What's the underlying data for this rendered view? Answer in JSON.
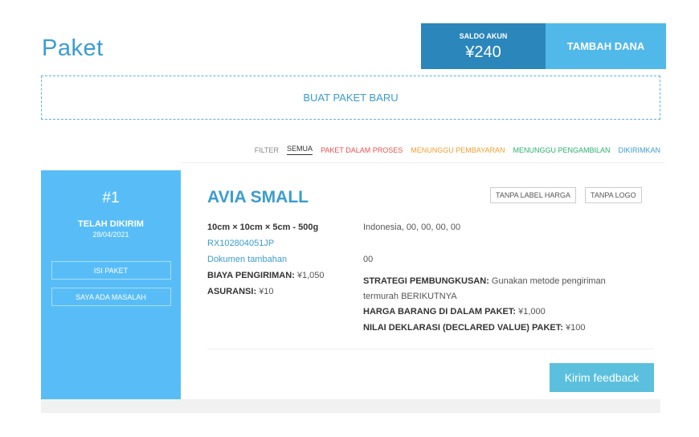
{
  "page": {
    "title": "Paket"
  },
  "account": {
    "balance_label": "SALDO AKUN",
    "balance_value": "¥240",
    "add_fund_label": "TAMBAH DANA"
  },
  "new_package_label": "BUAT PAKET BARU",
  "filter": {
    "label": "FILTER",
    "options": [
      "SEMUA",
      "PAKET DALAM PROSES",
      "MENUNGGU PEMBAYARAN",
      "MENUNGGU PENGAMBILAN",
      "DIKIRIMKAN"
    ],
    "selected": "SEMUA"
  },
  "order": {
    "number": "#1",
    "status": "TELAH DIKIRIM",
    "date": "28/04/2021",
    "actions": [
      "ISI PAKET",
      "SAYA ADA MASALAH"
    ],
    "product_name": "AVIA SMALL",
    "tags": [
      "TANPA LABEL HARGA",
      "TANPA LOGO"
    ],
    "dimensions": "10cm × 10cm × 5cm - 500g",
    "tracking": "RX102804051JP",
    "extra_docs": "Dokumen tambahan",
    "shipping_cost_label": "BIAYA PENGIRIMAN:",
    "shipping_cost_value": "¥1,050",
    "insurance_label": "ASURANSI:",
    "insurance_value": "¥10",
    "address": "Indonesia, 00, 00, 00, 00",
    "code": "00",
    "packing_label": "STRATEGI PEMBUNGKUSAN:",
    "packing_value_1": "Gunakan metode pengiriman",
    "packing_value_2": "termurah BERIKUTNYA",
    "item_price_label": "HARGA BARANG DI DALAM PAKET:",
    "item_price_value": "¥1,000",
    "declared_label": "NILAI DEKLARASI (DECLARED VALUE) PAKET:",
    "declared_value": "¥100",
    "feedback_label": "Kirim feedback"
  },
  "colors": {
    "accent": "#3a9ccf",
    "balance_bg": "#2b86bb",
    "add_fund_bg": "#51b8ea",
    "side_panel_bg": "#58bdf7",
    "feedback_bg": "#5bc0de",
    "filter_process": "#e8514f",
    "filter_payment": "#f0a02e",
    "filter_pickup": "#27b36b",
    "filter_sent": "#3a9ccf"
  }
}
